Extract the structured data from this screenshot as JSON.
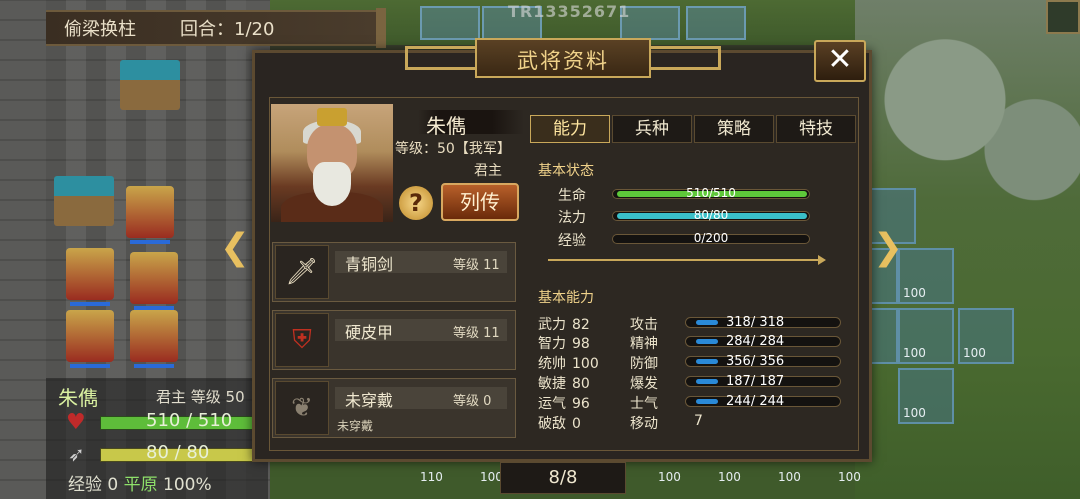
{
  "map": {
    "watermark": "TR13352671",
    "tile_values": [
      "100",
      "100",
      "100",
      "100",
      "110",
      "100",
      "100",
      "100",
      "100",
      "100"
    ]
  },
  "strategy": {
    "name": "偷梁换柱",
    "round": "回合：1/20"
  },
  "unit_info": {
    "name": "朱儁",
    "rank_level": "君主  等级 50",
    "hp": "510 / 510",
    "mp": "80 / 80",
    "exp_label": "经验",
    "exp_value": "0",
    "terrain": "平原",
    "terrain_pct": "100%"
  },
  "dialog": {
    "title": "武将资料",
    "close_label": "✕",
    "general": {
      "name": "朱儁",
      "level": "等级：50【我军】",
      "rank": "君主"
    },
    "help_label": "?",
    "bio_label": "列传",
    "equipment": [
      {
        "icon": "sword-icon",
        "name": "青铜剑",
        "level": "等级 11",
        "note": ""
      },
      {
        "icon": "armor-icon",
        "name": "硬皮甲",
        "level": "等级 11",
        "note": ""
      },
      {
        "icon": "accessory-icon",
        "name": "未穿戴",
        "level": "等级 0",
        "note": "未穿戴"
      }
    ],
    "tabs": [
      "能力",
      "兵种",
      "策略",
      "特技"
    ],
    "active_tab": 0,
    "basic_status": {
      "heading": "基本状态",
      "stats": [
        {
          "label": "生命",
          "value": "510/510",
          "fraction": 1.0,
          "color": "#5ec83a"
        },
        {
          "label": "法力",
          "value": "80/80",
          "fraction": 1.0,
          "color": "#3ac0c8"
        },
        {
          "label": "经验",
          "value": "0/200",
          "fraction": 0.0,
          "color": "#c8a83a"
        }
      ]
    },
    "basic_ability": {
      "heading": "基本能力",
      "left": [
        {
          "label": "武力",
          "value": "82"
        },
        {
          "label": "智力",
          "value": "98"
        },
        {
          "label": "统帅",
          "value": "100"
        },
        {
          "label": "敏捷",
          "value": "80"
        },
        {
          "label": "运气",
          "value": "96"
        },
        {
          "label": "破敌",
          "value": "0"
        }
      ],
      "right": [
        {
          "label": "攻击",
          "value": "318/ 318"
        },
        {
          "label": "精神",
          "value": "284/ 284"
        },
        {
          "label": "防御",
          "value": "356/ 356"
        },
        {
          "label": "爆发",
          "value": "187/ 187"
        },
        {
          "label": "士气",
          "value": "244/ 244"
        },
        {
          "label": "移动",
          "value": "7"
        }
      ]
    },
    "pager": "8/8"
  }
}
